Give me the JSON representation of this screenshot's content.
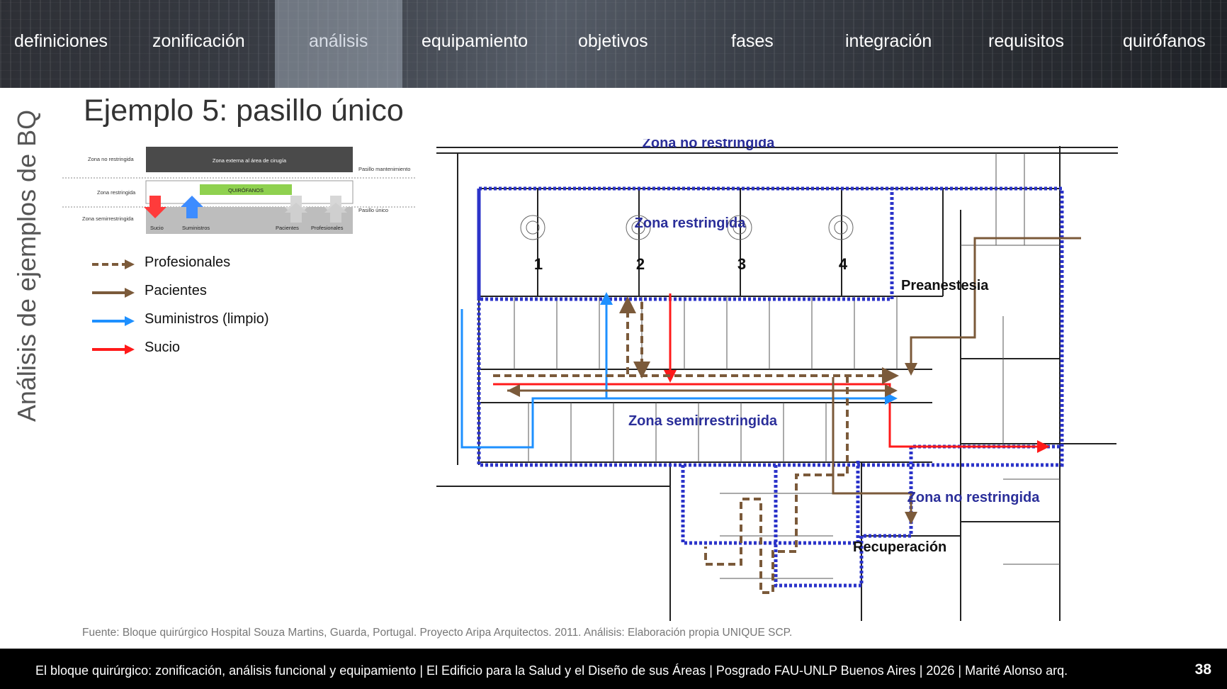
{
  "nav": {
    "items": [
      "definiciones",
      "zonificación",
      "análisis",
      "equipamiento",
      "objetivos",
      "fases",
      "integración",
      "requisitos",
      "quirófanos"
    ],
    "active": "análisis"
  },
  "side_title": "Análisis de ejemplos de BQ",
  "title": "Ejemplo 5: pasillo único",
  "scheme": {
    "zone_unrestricted": "Zona no restringida",
    "zone_restricted": "Zona restringida",
    "zone_semirestricted": "Zona semirrestringida",
    "external_box": "Zona externa al área de cirugía",
    "or_box": "QUIRÓFANOS",
    "maintenance_corridor": "Pasillo mantenimiento",
    "single_corridor": "Pasillo único",
    "flows": [
      "Sucio",
      "Suministros",
      "Pacientes",
      "Profesionales"
    ]
  },
  "legend": [
    {
      "label": "Profesionales",
      "color": "#7b5a3a",
      "style": "dashed"
    },
    {
      "label": "Pacientes",
      "color": "#7b5a3a",
      "style": "solid"
    },
    {
      "label": "Suministros (limpio)",
      "color": "#1e90ff",
      "style": "solid"
    },
    {
      "label": "Sucio",
      "color": "#ff1a1a",
      "style": "solid"
    }
  ],
  "plan": {
    "zone_top": "Zona no restringida",
    "zone_restricted": "Zona restringida",
    "zone_semi": "Zona semirrestringida",
    "zone_right": "Zona no restringida",
    "preanestesia": "Preanestesia",
    "recuperacion": "Recuperación",
    "or_numbers": [
      "1",
      "2",
      "3",
      "4"
    ],
    "label_color": "#2b2f9a"
  },
  "source": "Fuente: Bloque quirúrgico Hospital Souza Martins, Guarda, Portugal. Proyecto Aripa Arquitectos. 2011. Análisis: Elaboración propia UNIQUE SCP.",
  "footer": {
    "text": "El bloque quirúrgico: zonificación, análisis funcional y equipamiento  |  El Edificio para la Salud y el Diseño de sus Áreas  |  Posgrado FAU-UNLP Buenos Aires  |  2026  |  Marité Alonso arq.",
    "page": "38"
  }
}
